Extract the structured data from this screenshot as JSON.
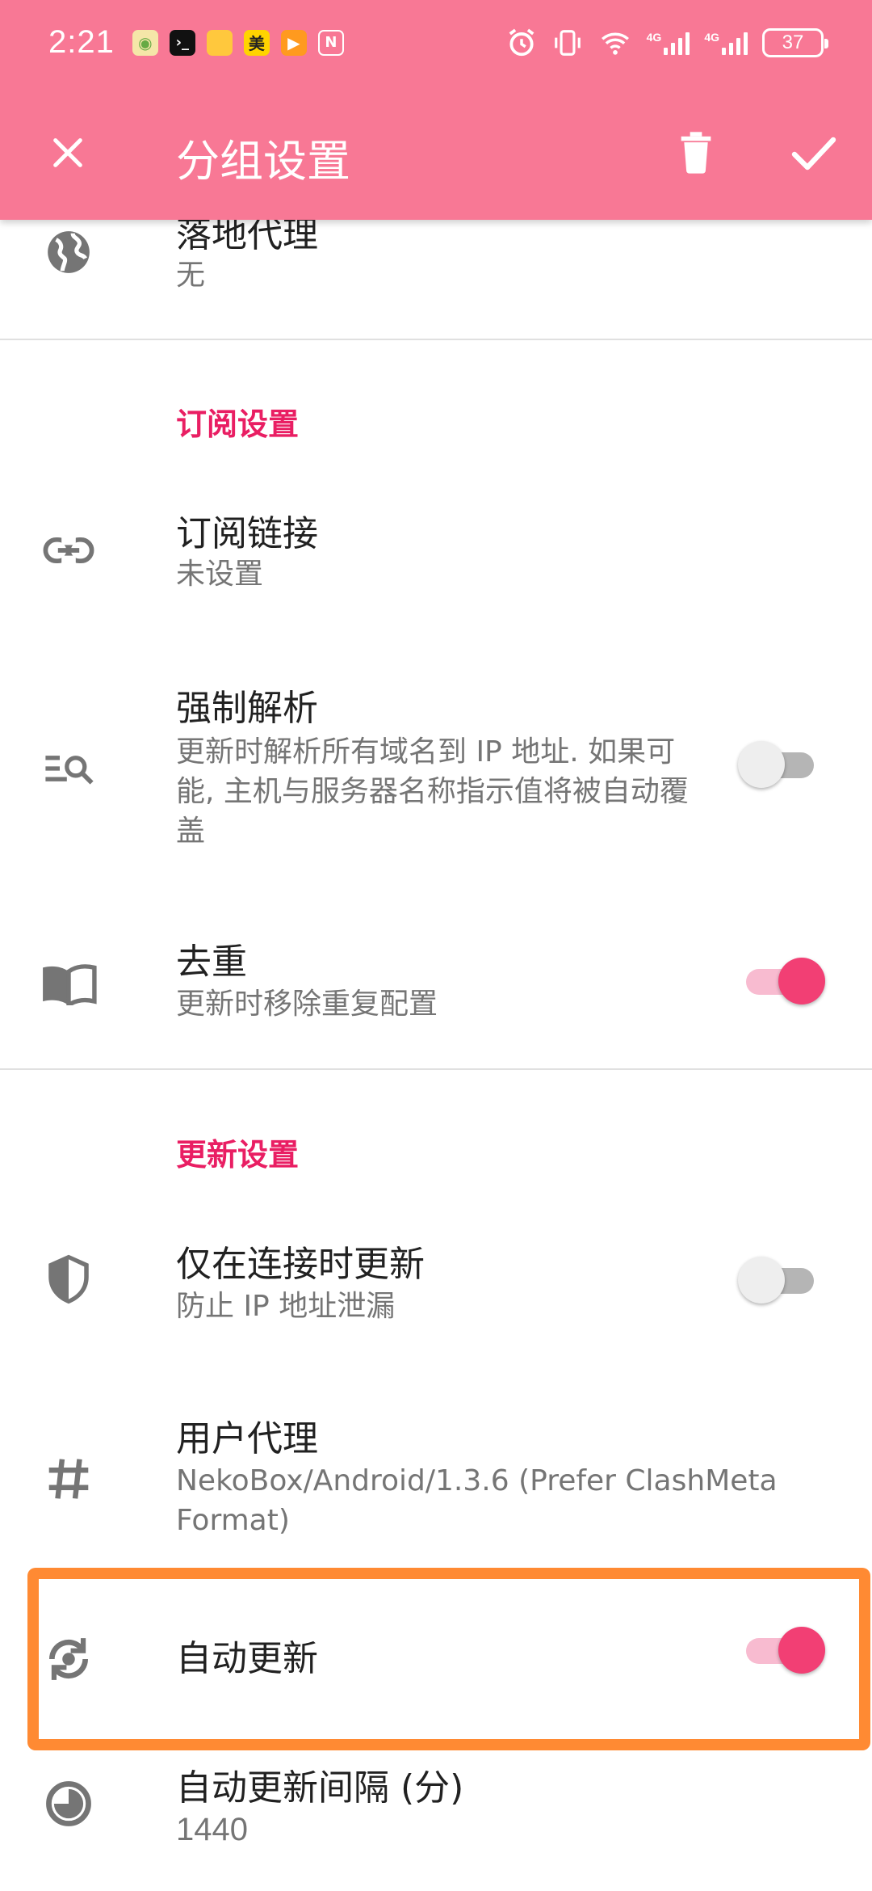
{
  "status_bar": {
    "time": "2:21",
    "battery": "37",
    "net1": "4G",
    "net2": "4G"
  },
  "toolbar": {
    "title": "分组设置"
  },
  "rows": {
    "landing_proxy": {
      "title": "落地代理",
      "subtitle": "无"
    },
    "subscription_link": {
      "title": "订阅链接",
      "subtitle": "未设置"
    },
    "force_resolve": {
      "title": "强制解析",
      "subtitle": "更新时解析所有域名到 IP 地址. 如果可能, 主机与服务器名称指示值将被自动覆盖",
      "enabled": false
    },
    "dedupe": {
      "title": "去重",
      "subtitle": "更新时移除重复配置",
      "enabled": true
    },
    "update_when_connected": {
      "title": "仅在连接时更新",
      "subtitle": "防止 IP 地址泄漏",
      "enabled": false
    },
    "user_agent": {
      "title": "用户代理",
      "subtitle": "NekoBox/Android/1.3.6 (Prefer ClashMeta Format)"
    },
    "auto_update": {
      "title": "自动更新",
      "enabled": true
    },
    "auto_update_interval": {
      "title": "自动更新间隔 (分)",
      "subtitle": "1440"
    }
  },
  "sections": {
    "subscription": "订阅设置",
    "update": "更新设置"
  },
  "colors": {
    "appbar": "#F87895",
    "accent": "#E91E63",
    "switch_on": "#F23F74",
    "highlight": "#FF8A33"
  }
}
